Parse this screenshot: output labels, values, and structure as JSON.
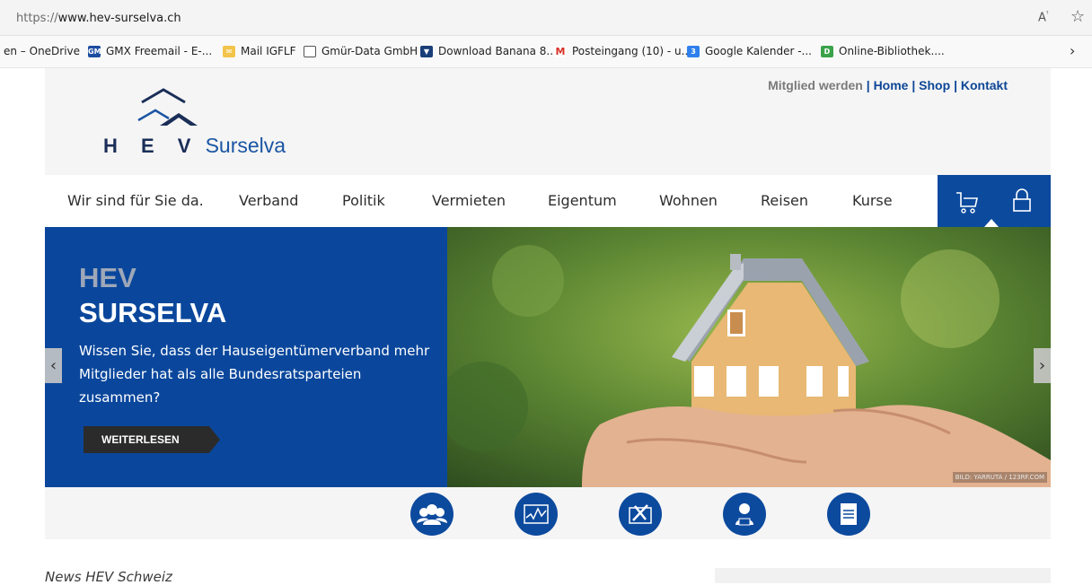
{
  "browser": {
    "url_scheme": "https://",
    "url_host": "www.hev-surselva.ch",
    "read_aloud_icon": "read-aloud-icon",
    "favorite_icon": "star-icon"
  },
  "favorites": [
    {
      "label": "en – OneDrive",
      "icon": "none"
    },
    {
      "label": "GMX Freemail - E-...",
      "icon": "gmx-icon"
    },
    {
      "label": "Mail IGFLF",
      "icon": "mail-icon"
    },
    {
      "label": "Gmür-Data GmbH",
      "icon": "page-icon"
    },
    {
      "label": "Download Banana 8...",
      "icon": "banana-icon"
    },
    {
      "label": "Posteingang (10) - u...",
      "icon": "gmail-icon"
    },
    {
      "label": "Google Kalender -...",
      "icon": "calendar-icon"
    },
    {
      "label": "Online-Bibliothek....",
      "icon": "library-icon"
    }
  ],
  "logo": {
    "letters": "H E V",
    "name": "Surselva"
  },
  "toplinks": {
    "join": "Mitglied werden",
    "home": "Home",
    "shop": "Shop",
    "contact": "Kontakt",
    "separator": "|"
  },
  "nav": [
    "Wir sind für Sie da.",
    "Verband",
    "Politik",
    "Vermieten",
    "Eigentum",
    "Wohnen",
    "Reisen",
    "Kurse"
  ],
  "hero": {
    "kicker": "HEV",
    "title": "SURSELVA",
    "text": "Wissen Sie, dass der Hauseigentümerverband mehr Mitglieder hat als alle Bundesratsparteien zusammen?",
    "button": "WEITERLESEN",
    "credit": "BILD: YARRUTA / 123RF.COM",
    "prev": "‹",
    "next": "›"
  },
  "quick_icons": [
    "members-icon",
    "chart-icon",
    "tools-icon",
    "advisor-icon",
    "news-doc-icon"
  ],
  "news": {
    "title": "News HEV Schweiz"
  },
  "colors": {
    "brand_blue": "#0c4a9e",
    "dark_button": "#2b2b2b",
    "header_bg": "#f5f5f5"
  }
}
